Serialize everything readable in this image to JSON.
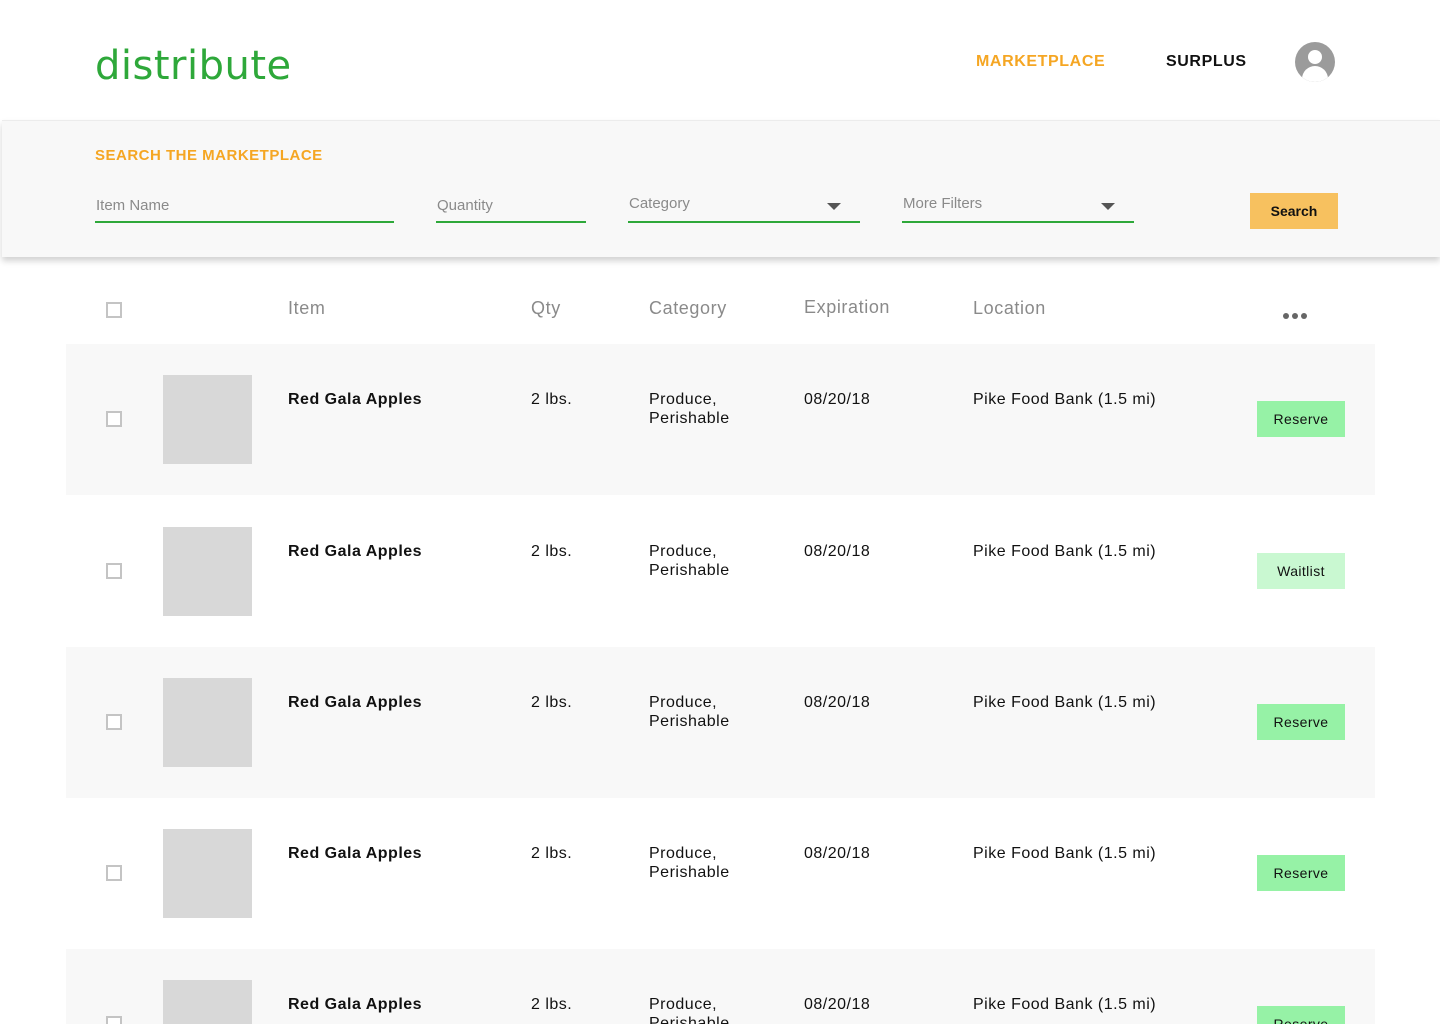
{
  "header": {
    "logo": "distribute",
    "nav": {
      "marketplace": "MARKETPLACE",
      "surplus": "SURPLUS"
    },
    "colors": {
      "brand": "#2ea83a",
      "active_nav": "#f5a623"
    }
  },
  "search": {
    "title": "SEARCH THE MARKETPLACE",
    "item_placeholder": "Item Name",
    "quantity_placeholder": "Quantity",
    "category_placeholder": "Category",
    "more_filters_placeholder": "More Filters",
    "button_label": "Search",
    "button_color": "#f7c15f"
  },
  "table": {
    "columns": [
      "Item",
      "Qty",
      "Category",
      "Expiration",
      "Location"
    ],
    "rows": [
      {
        "item": "Red Gala Apples",
        "qty": "2 lbs.",
        "category_line1": "Produce,",
        "category_line2": "Perishable",
        "expiration": "08/20/18",
        "location": "Pike Food Bank (1.5 mi)",
        "action": "Reserve"
      },
      {
        "item": "Red Gala Apples",
        "qty": "2 lbs.",
        "category_line1": "Produce,",
        "category_line2": "Perishable",
        "expiration": "08/20/18",
        "location": "Pike Food Bank (1.5 mi)",
        "action": "Waitlist"
      },
      {
        "item": "Red Gala Apples",
        "qty": "2 lbs.",
        "category_line1": "Produce,",
        "category_line2": "Perishable",
        "expiration": "08/20/18",
        "location": "Pike Food Bank (1.5 mi)",
        "action": "Reserve"
      },
      {
        "item": "Red Gala Apples",
        "qty": "2 lbs.",
        "category_line1": "Produce,",
        "category_line2": "Perishable",
        "expiration": "08/20/18",
        "location": "Pike Food Bank (1.5 mi)",
        "action": "Reserve"
      },
      {
        "item": "Red Gala Apples",
        "qty": "2 lbs.",
        "category_line1": "Produce,",
        "category_line2": "Perishable",
        "expiration": "08/20/18",
        "location": "Pike Food Bank (1.5 mi)",
        "action": "Reserve"
      }
    ],
    "icons": {
      "row_menu": "more-horizontal-icon",
      "profile": "user-avatar-icon",
      "dropdown": "caret-down-icon"
    }
  }
}
